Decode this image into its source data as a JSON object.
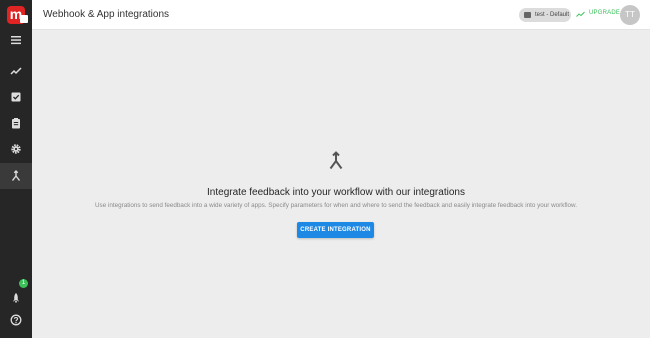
{
  "app": {
    "logo_letter": "m",
    "page_title": "Webhook & App integrations"
  },
  "sidebar": {
    "items": [
      {
        "icon": "menu-icon"
      },
      {
        "icon": "trend-icon"
      },
      {
        "icon": "checklist-icon"
      },
      {
        "icon": "clipboard-icon"
      },
      {
        "icon": "gear-icon"
      },
      {
        "icon": "merge-icon",
        "active": true
      }
    ],
    "bottom": [
      {
        "icon": "rocket-icon",
        "badge": "1"
      },
      {
        "icon": "help-icon"
      }
    ]
  },
  "header": {
    "workspace": "test - Default",
    "upgrade_label": "UPGRADE",
    "avatar_initials": "TT"
  },
  "main": {
    "heading": "Integrate feedback into your workflow with our integrations",
    "description": "Use integrations to send feedback into a wide variety of apps. Specify parameters for when and where to send the feedback and easily integrate feedback into your workflow.",
    "cta_label": "CREATE INTEGRATION"
  },
  "colors": {
    "brand": "#e02424",
    "accent": "#1e88e5",
    "upgrade": "#3cc15a",
    "sidebar_bg": "#262626"
  }
}
